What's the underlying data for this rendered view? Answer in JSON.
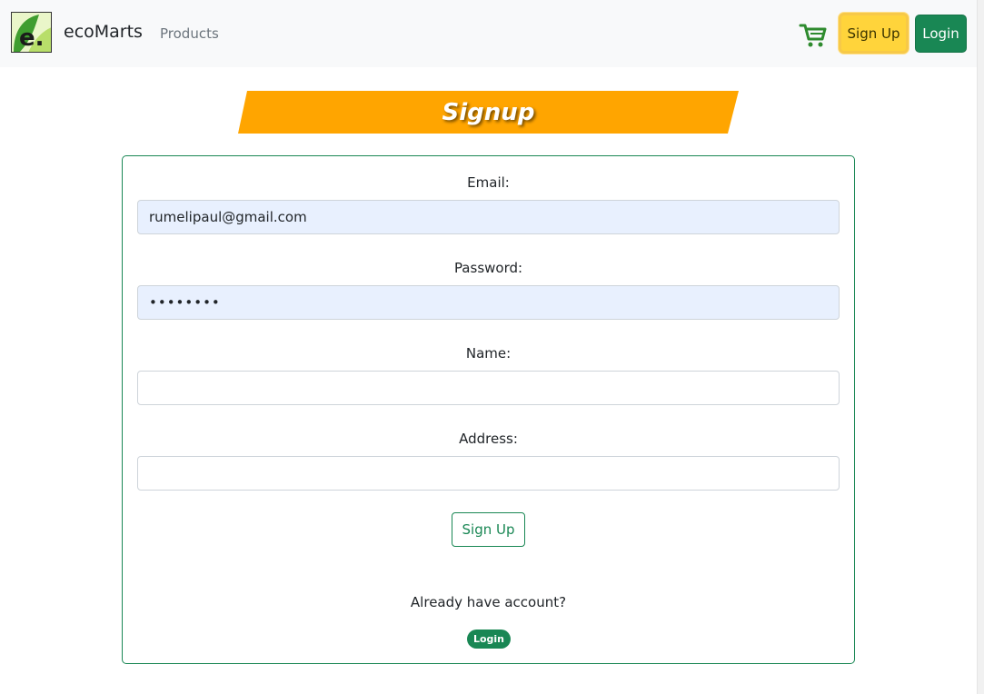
{
  "navbar": {
    "brand_logo_text": "e.",
    "brand_name": "ecoMarts",
    "products_link": "Products",
    "signup_button": "Sign Up",
    "login_button": "Login"
  },
  "banner": {
    "title": "Signup"
  },
  "form": {
    "email": {
      "label": "Email:",
      "value": "rumelipaul@gmail.com"
    },
    "password": {
      "label": "Password:",
      "value": "••••••••"
    },
    "name": {
      "label": "Name:",
      "value": ""
    },
    "address": {
      "label": "Address:",
      "value": ""
    },
    "submit_button": "Sign Up",
    "already_text": "Already have account?",
    "login_link": "Login"
  },
  "colors": {
    "success": "#198754",
    "warning": "#ffd43b",
    "banner": "#ffa500",
    "autofill": "#e8f0fe"
  }
}
